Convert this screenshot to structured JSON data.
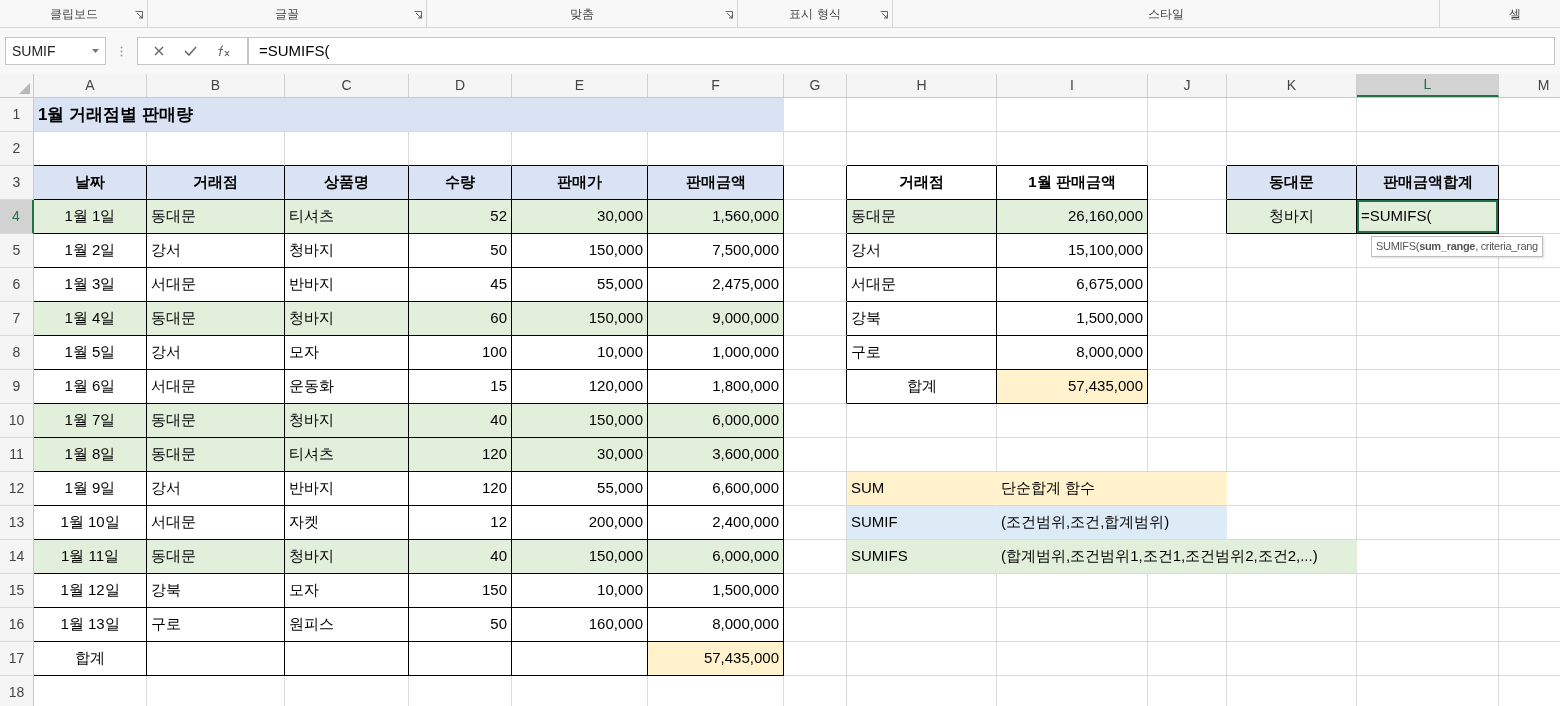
{
  "ribbon_groups": [
    {
      "label": "클립보드",
      "launcher": true
    },
    {
      "label": "글꼴",
      "launcher": true
    },
    {
      "label": "맞춤",
      "launcher": true
    },
    {
      "label": "표시 형식",
      "launcher": true
    },
    {
      "label": "스타일",
      "launcher": false
    },
    {
      "label": "셀",
      "launcher": false
    }
  ],
  "name_box": "SUMIF",
  "formula": "=SUMIFS(",
  "columns": [
    {
      "label": "A",
      "selected": false
    },
    {
      "label": "B",
      "selected": false
    },
    {
      "label": "C",
      "selected": false
    },
    {
      "label": "D",
      "selected": false
    },
    {
      "label": "E",
      "selected": false
    },
    {
      "label": "F",
      "selected": false
    },
    {
      "label": "G",
      "selected": false
    },
    {
      "label": "H",
      "selected": false
    },
    {
      "label": "I",
      "selected": false
    },
    {
      "label": "J",
      "selected": false
    },
    {
      "label": "K",
      "selected": false
    },
    {
      "label": "L",
      "selected": true
    },
    {
      "label": "M",
      "selected": false
    }
  ],
  "rows": [
    {
      "label": "1",
      "selected": false
    },
    {
      "label": "2",
      "selected": false
    },
    {
      "label": "3",
      "selected": false
    },
    {
      "label": "4",
      "selected": true
    },
    {
      "label": "5",
      "selected": false
    },
    {
      "label": "6",
      "selected": false
    },
    {
      "label": "7",
      "selected": false
    },
    {
      "label": "8",
      "selected": false
    },
    {
      "label": "9",
      "selected": false
    },
    {
      "label": "10",
      "selected": false
    },
    {
      "label": "11",
      "selected": false
    },
    {
      "label": "12",
      "selected": false
    },
    {
      "label": "13",
      "selected": false
    },
    {
      "label": "14",
      "selected": false
    },
    {
      "label": "15",
      "selected": false
    },
    {
      "label": "16",
      "selected": false
    },
    {
      "label": "17",
      "selected": false
    },
    {
      "label": "18",
      "selected": false
    }
  ],
  "title": "1월 거래점별 판매량",
  "sales_table": {
    "columns": [
      "날짜",
      "거래점",
      "상품명",
      "수량",
      "판매가",
      "판매금액"
    ],
    "rows": [
      {
        "cells": [
          "1월 1일",
          "동대문",
          "티셔츠",
          "52",
          "30,000",
          "1,560,000"
        ],
        "highlighted": true
      },
      {
        "cells": [
          "1월 2일",
          "강서",
          "청바지",
          "50",
          "150,000",
          "7,500,000"
        ],
        "highlighted": false
      },
      {
        "cells": [
          "1월 3일",
          "서대문",
          "반바지",
          "45",
          "55,000",
          "2,475,000"
        ],
        "highlighted": false
      },
      {
        "cells": [
          "1월 4일",
          "동대문",
          "청바지",
          "60",
          "150,000",
          "9,000,000"
        ],
        "highlighted": true
      },
      {
        "cells": [
          "1월 5일",
          "강서",
          "모자",
          "100",
          "10,000",
          "1,000,000"
        ],
        "highlighted": false
      },
      {
        "cells": [
          "1월 6일",
          "서대문",
          "운동화",
          "15",
          "120,000",
          "1,800,000"
        ],
        "highlighted": false
      },
      {
        "cells": [
          "1월 7일",
          "동대문",
          "청바지",
          "40",
          "150,000",
          "6,000,000"
        ],
        "highlighted": true
      },
      {
        "cells": [
          "1월 8일",
          "동대문",
          "티셔츠",
          "120",
          "30,000",
          "3,600,000"
        ],
        "highlighted": true
      },
      {
        "cells": [
          "1월 9일",
          "강서",
          "반바지",
          "120",
          "55,000",
          "6,600,000"
        ],
        "highlighted": false
      },
      {
        "cells": [
          "1월 10일",
          "서대문",
          "자켓",
          "12",
          "200,000",
          "2,400,000"
        ],
        "highlighted": false
      },
      {
        "cells": [
          "1월 11일",
          "동대문",
          "청바지",
          "40",
          "150,000",
          "6,000,000"
        ],
        "highlighted": true
      },
      {
        "cells": [
          "1월 12일",
          "강북",
          "모자",
          "150",
          "10,000",
          "1,500,000"
        ],
        "highlighted": false
      },
      {
        "cells": [
          "1월 13일",
          "구로",
          "원피스",
          "50",
          "160,000",
          "8,000,000"
        ],
        "highlighted": false
      }
    ],
    "total": {
      "label": "합계",
      "value": "57,435,000"
    }
  },
  "store_summary": {
    "columns": [
      "거래점",
      "1월 판매금액"
    ],
    "rows": [
      {
        "store": "동대문",
        "amount": "26,160,000",
        "highlighted": true
      },
      {
        "store": "강서",
        "amount": "15,100,000",
        "highlighted": false
      },
      {
        "store": "서대문",
        "amount": "6,675,000",
        "highlighted": false
      },
      {
        "store": "강북",
        "amount": "1,500,000",
        "highlighted": false
      },
      {
        "store": "구로",
        "amount": "8,000,000",
        "highlighted": false
      }
    ],
    "total": {
      "label": "합계",
      "value": "57,435,000"
    }
  },
  "criteria": {
    "columns": [
      "동대문",
      "판매금액합계"
    ],
    "condition": "청바지",
    "formula": "=SUMIFS("
  },
  "tooltip": "SUMIFS(**sum_range**, criteria_rang",
  "notes": [
    {
      "name": "SUM",
      "description": "단순합계 함수",
      "color": "#fff2cc"
    },
    {
      "name": "SUMIF",
      "description": "(조건범위,조건,합계범위)",
      "color": "#ddebf7"
    },
    {
      "name": "SUMIFS",
      "description": "(합계범위,조건범위1,조건1,조건범위2,조건2,...)",
      "color": "#e2efda"
    }
  ]
}
